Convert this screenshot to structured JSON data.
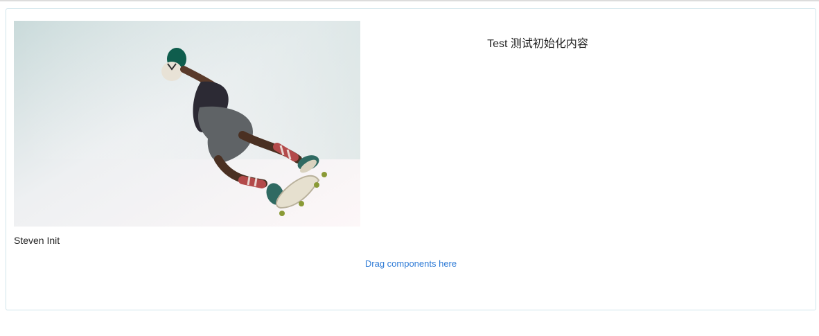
{
  "image": {
    "subject": "skateboarder mid-air photo"
  },
  "heading": "Test 测试初始化内容",
  "caption": "Steven Init",
  "drop_zone": {
    "label": "Drag components here"
  },
  "colors": {
    "border": "#cfe4ea",
    "link": "#2d7ad6"
  }
}
